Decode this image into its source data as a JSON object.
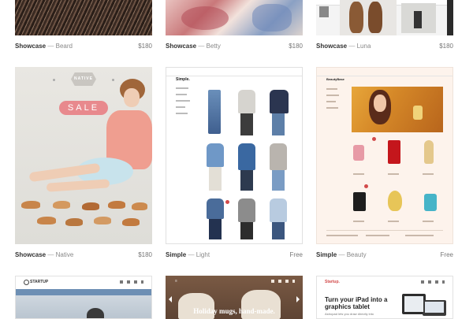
{
  "cards": [
    {
      "name": "Showcase",
      "sep": "—",
      "variant": "Beard",
      "price": "$180"
    },
    {
      "name": "Showcase",
      "sep": "—",
      "variant": "Betty",
      "price": "$180"
    },
    {
      "name": "Showcase",
      "sep": "—",
      "variant": "Luna",
      "price": "$180"
    },
    {
      "name": "Showcase",
      "sep": "—",
      "variant": "Native",
      "price": "$180"
    },
    {
      "name": "Simple",
      "sep": "—",
      "variant": "Light",
      "price": "Free"
    },
    {
      "name": "Simple",
      "sep": "—",
      "variant": "Beauty",
      "price": "Free"
    }
  ],
  "native": {
    "logo": "NATIVE",
    "sale": "SALE"
  },
  "simple": {
    "logo": "Simple."
  },
  "beauty": {
    "logo": "BeautyBase"
  },
  "bottom": {
    "startup_logo": "STARTUP",
    "mugs_title": "Holiday mugs, hand-made.",
    "tablet_logo": "Startup.",
    "tablet_title": "Turn your iPad into a graphics tablet",
    "tablet_sub": "Astropad lets you draw directly into"
  },
  "colors": {
    "sale_pill": "#e8898d",
    "accent": "#d24a4a"
  }
}
